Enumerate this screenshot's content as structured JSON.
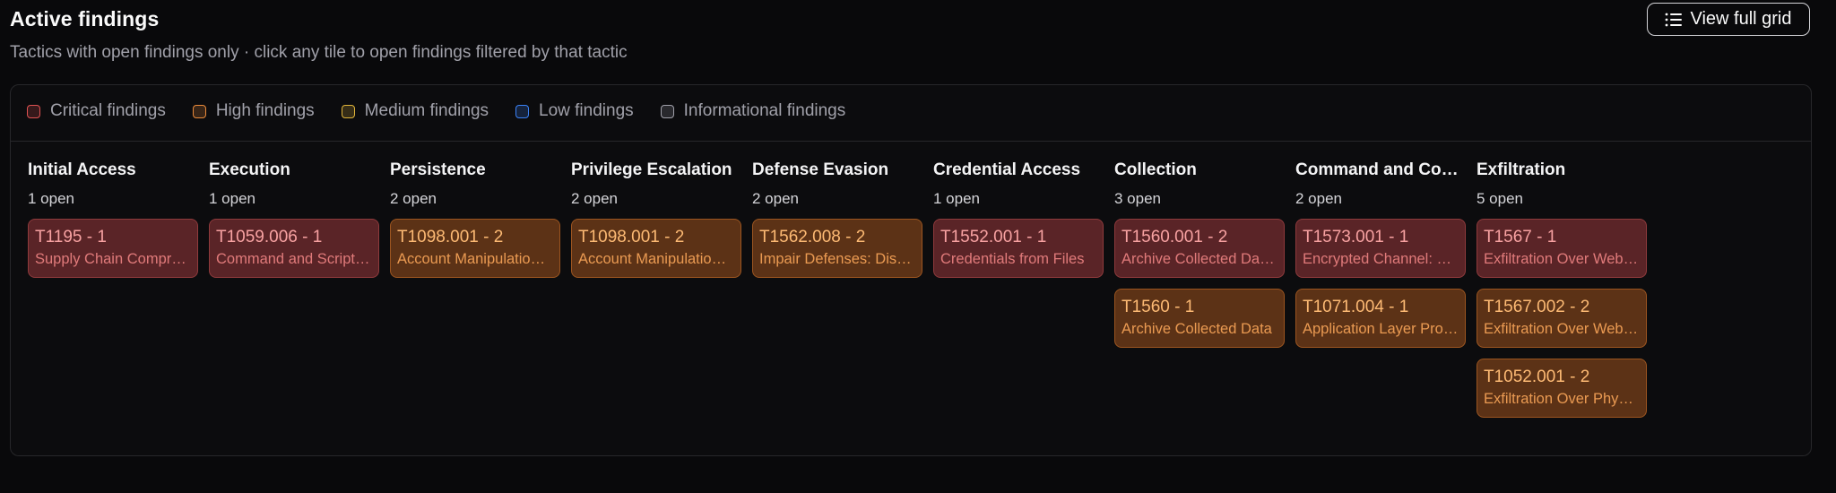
{
  "header": {
    "title": "Active findings",
    "subtitle": "Tactics with open findings only · click any tile to open findings filtered by that tactic",
    "view_grid_label": "View full grid"
  },
  "legend": [
    {
      "label": "Critical findings",
      "color": "#e05252"
    },
    {
      "label": "High findings",
      "color": "#ea8a3a"
    },
    {
      "label": "Medium findings",
      "color": "#e0b43a"
    },
    {
      "label": "Low findings",
      "color": "#3b82f6"
    },
    {
      "label": "Informational findings",
      "color": "#a1a1aa"
    }
  ],
  "tactics": [
    {
      "name": "Initial Access",
      "count": "1 open",
      "tiles": [
        {
          "id": "T1195 - 1",
          "name": "Supply Chain Compromise",
          "severity": "critical"
        }
      ]
    },
    {
      "name": "Execution",
      "count": "1 open",
      "tiles": [
        {
          "id": "T1059.006 - 1",
          "name": "Command and Scripting Interpreter: Python",
          "severity": "critical"
        }
      ]
    },
    {
      "name": "Persistence",
      "count": "2 open",
      "tiles": [
        {
          "id": "T1098.001 - 2",
          "name": "Account Manipulation: Additional Cloud Credentials",
          "severity": "high"
        }
      ]
    },
    {
      "name": "Privilege Escalation",
      "count": "2 open",
      "tiles": [
        {
          "id": "T1098.001 - 2",
          "name": "Account Manipulation: Additional Cloud Credentials",
          "severity": "high"
        }
      ]
    },
    {
      "name": "Defense Evasion",
      "count": "2 open",
      "tiles": [
        {
          "id": "T1562.008 - 2",
          "name": "Impair Defenses: Disable or Modify Cloud Logs",
          "severity": "high"
        }
      ]
    },
    {
      "name": "Credential Access",
      "count": "1 open",
      "tiles": [
        {
          "id": "T1552.001 - 1",
          "name": "Credentials from Files",
          "severity": "critical"
        }
      ]
    },
    {
      "name": "Collection",
      "count": "3 open",
      "tiles": [
        {
          "id": "T1560.001 - 2",
          "name": "Archive Collected Data: Archive via Utility",
          "severity": "critical"
        },
        {
          "id": "T1560 - 1",
          "name": "Archive Collected Data",
          "severity": "high"
        }
      ]
    },
    {
      "name": "Command and Control",
      "count": "2 open",
      "tiles": [
        {
          "id": "T1573.001 - 1",
          "name": "Encrypted Channel: Symmetric Cryptography",
          "severity": "critical"
        },
        {
          "id": "T1071.004 - 1",
          "name": "Application Layer Protocol: DNS",
          "severity": "high"
        }
      ]
    },
    {
      "name": "Exfiltration",
      "count": "5 open",
      "tiles": [
        {
          "id": "T1567 - 1",
          "name": "Exfiltration Over Web Service",
          "severity": "critical"
        },
        {
          "id": "T1567.002 - 2",
          "name": "Exfiltration Over Web Service: Exfiltration to Cloud Storage",
          "severity": "high"
        },
        {
          "id": "T1052.001 - 2",
          "name": "Exfiltration Over Physical Medium: Exfiltration over USB",
          "severity": "high"
        }
      ]
    }
  ]
}
